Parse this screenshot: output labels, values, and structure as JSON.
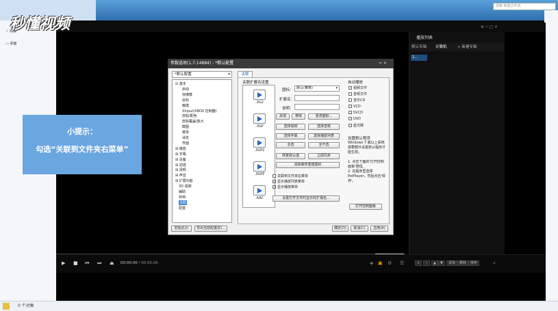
{
  "explorer": {
    "search_placeholder": "搜索 新建文件夹",
    "left_items": [
      "收藏",
      "桌面"
    ],
    "status_text": "0 个对象"
  },
  "player": {
    "playlist_title": "播放列表",
    "playlist_tabs": [
      "默认专辑",
      "计算机",
      "+ 新建专辑"
    ],
    "playlist_item": "1...",
    "time_current": "00:00:00",
    "time_total": "00:00:00",
    "playlist_buttons": [
      "添加",
      "删除",
      "排序"
    ]
  },
  "logo_text": "秒懂视频",
  "tip": {
    "title": "小提示：",
    "body": "勾选“关联到文件夹右菜单”"
  },
  "dialog": {
    "title": "参数选项(1.7.14884) - *默认配置",
    "title_controls": "≈  ✕",
    "profile": "*默认配置",
    "tab": "关联",
    "tree": [
      {
        "label": "⊟ 基本",
        "level": 0
      },
      {
        "label": "启动",
        "level": 2
      },
      {
        "label": "快捷键",
        "level": 2
      },
      {
        "label": "鼠标",
        "level": 2
      },
      {
        "label": "触摸",
        "level": 2
      },
      {
        "label": "XInput(XBOX 控制器)",
        "level": 2
      },
      {
        "label": "皮肤/配色",
        "level": 2
      },
      {
        "label": "皮肤覆盖/放大",
        "level": 2
      },
      {
        "label": "截图",
        "level": 2
      },
      {
        "label": "菜单",
        "level": 2
      },
      {
        "label": "消息",
        "level": 2
      },
      {
        "label": "界面",
        "level": 2
      },
      {
        "label": "⊞ 播放",
        "level": 0
      },
      {
        "label": "⊞ 字幕",
        "level": 0
      },
      {
        "label": "⊞ 设备",
        "level": 0
      },
      {
        "label": "⊞ 滤镜",
        "level": 0
      },
      {
        "label": "⊞ 视频",
        "level": 0
      },
      {
        "label": "⊞ 声音",
        "level": 0
      },
      {
        "label": "⊞ 扩展功能",
        "level": 0
      },
      {
        "label": "3D 视频",
        "level": 1
      },
      {
        "label": "辅助",
        "level": 1
      },
      {
        "label": "存档",
        "level": 1
      },
      {
        "label": "关联",
        "level": 1,
        "selected": true
      },
      {
        "label": "配置",
        "level": 1
      }
    ],
    "assoc_group_label": "关联扩展名设置",
    "formats": [
      ".3G2",
      ".3GP",
      ".3GP2",
      ".3GPP",
      ".AAC"
    ],
    "icon_label": "图标：",
    "icon_value": "默认(推荐)",
    "ext_label": "扩展名：",
    "desc_label": "说明：",
    "btn_add": "添加",
    "btn_remove": "移除",
    "btn_change_icon": "更改图标...",
    "btn_select_video": "选择视频",
    "btn_select_audio": "选择音频",
    "btn_select_subtitle": "选择字幕",
    "btn_select_playlist": "选择播放列表",
    "btn_select_all": "全选",
    "btn_select_none": "全不选",
    "btn_restore_default": "恢复默认值",
    "btn_apply_now": "立即同步",
    "btn_clear_cache": "清除缓存重建图标",
    "chk_folder_menu": "关联到文件夹右菜单",
    "chk_show_playlist_menu": "显示播放列表菜单",
    "chk_show_play_menu": "显示播放菜单",
    "btn_set_open_with": "设置打开文件时显示的扩展名...",
    "autoplay_label": "自动播放",
    "autoplay_items": [
      "视频文件",
      "音频文件",
      "音乐CD",
      "VCD",
      "SVCD",
      "DVD",
      "蓝光碟"
    ],
    "default_program_label": "设置默认程序",
    "default_program_desc": "Windows 7 或以上系统需要额外设置默认程序才能生效。\n\n1. 点击下面的'打开控制面板'按钮。\n2. 在程序里选择PotPlayer，然后点击'保存'。",
    "btn_open_control_panel": "打开控制面板",
    "btn_init": "初始化(I)",
    "btn_export": "导出当前配置(E)...",
    "btn_ok": "确定(O)",
    "btn_cancel": "取消(C)",
    "btn_apply": "应用(A)"
  },
  "colors": {
    "tip_bg": "#6aa6e0",
    "selection": "#3b7fd1",
    "accent_blue": "#2a64b8"
  }
}
